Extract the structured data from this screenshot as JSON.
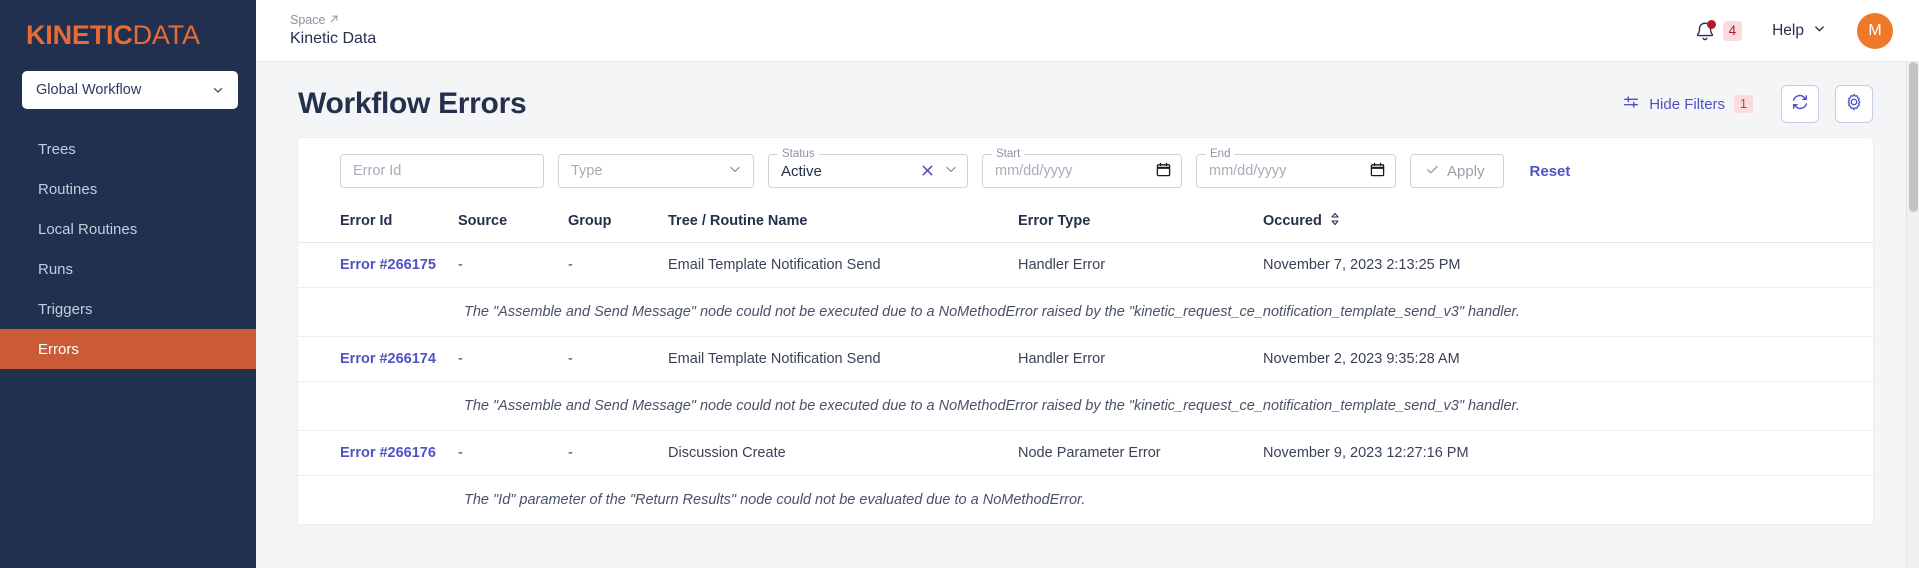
{
  "brand": {
    "part1": "KINETIC",
    "part2": "DATA"
  },
  "sidebar": {
    "space_selector": {
      "label": "Global Workflow",
      "icon": "chevron-down-icon"
    },
    "items": [
      {
        "label": "Trees",
        "active": false
      },
      {
        "label": "Routines",
        "active": false
      },
      {
        "label": "Local Routines",
        "active": false
      },
      {
        "label": "Runs",
        "active": false
      },
      {
        "label": "Triggers",
        "active": false
      },
      {
        "label": "Errors",
        "active": true
      }
    ]
  },
  "topbar": {
    "breadcrumb": {
      "kicker": "Space",
      "kicker_icon": "external-link-icon",
      "title": "Kinetic Data"
    },
    "notifications": {
      "icon": "bell-icon",
      "count": "4"
    },
    "help": {
      "label": "Help",
      "icon": "chevron-down-icon"
    },
    "avatar": {
      "initial": "M"
    }
  },
  "page": {
    "title": "Workflow Errors",
    "hide_filters": {
      "icon": "filters-icon",
      "label": "Hide Filters",
      "count": "1"
    },
    "refresh_button": {
      "icon": "refresh-icon"
    },
    "settings_button": {
      "icon": "gear-icon"
    }
  },
  "filters": {
    "error_id": {
      "placeholder": "Error Id",
      "value": ""
    },
    "type": {
      "placeholder": "Type",
      "value": "",
      "icon": "chevron-down-icon"
    },
    "status": {
      "label": "Status",
      "value": "Active",
      "clear_icon": "x-icon",
      "icon": "chevron-down-icon"
    },
    "start": {
      "label": "Start",
      "placeholder": "mm/dd/yyyy",
      "value": "",
      "icon": "calendar-icon"
    },
    "end": {
      "label": "End",
      "placeholder": "mm/dd/yyyy",
      "value": "",
      "icon": "calendar-icon"
    },
    "apply": {
      "label": "Apply",
      "icon": "check-icon"
    },
    "reset": {
      "label": "Reset"
    }
  },
  "table": {
    "columns": [
      "Error Id",
      "Source",
      "Group",
      "Tree / Routine Name",
      "Error Type",
      "Occured"
    ],
    "sort_icon": "sort-updown-icon",
    "rows": [
      {
        "error_id": "Error #266175",
        "source": "-",
        "group": "-",
        "tree_routine_name": "Email Template Notification Send",
        "error_type": "Handler Error",
        "occured": "November 7, 2023 2:13:25 PM",
        "description": "The \"Assemble and Send Message\" node could not be executed due to a NoMethodError raised by the \"kinetic_request_ce_notification_template_send_v3\" handler."
      },
      {
        "error_id": "Error #266174",
        "source": "-",
        "group": "-",
        "tree_routine_name": "Email Template Notification Send",
        "error_type": "Handler Error",
        "occured": "November 2, 2023 9:35:28 AM",
        "description": "The \"Assemble and Send Message\" node could not be executed due to a NoMethodError raised by the \"kinetic_request_ce_notification_template_send_v3\" handler."
      },
      {
        "error_id": "Error #266176",
        "source": "-",
        "group": "-",
        "tree_routine_name": "Discussion Create",
        "error_type": "Node Parameter Error",
        "occured": "November 9, 2023 12:27:16 PM",
        "description": "The \"Id\" parameter of the \"Return Results\" node could not be evaluated due to a NoMethodError."
      }
    ]
  },
  "colors": {
    "sidebar_bg": "#22304f",
    "brand_orange": "#ea6a36",
    "active_item": "#cb5a37",
    "link_indigo": "#4d52c7",
    "avatar_orange": "#f07929",
    "badge_pink_bg": "#fadbdf",
    "badge_red_text": "#b4182d"
  }
}
